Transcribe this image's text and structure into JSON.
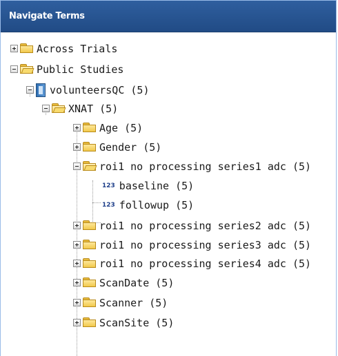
{
  "panel": {
    "title": "Navigate Terms"
  },
  "tree": {
    "across_trials": "Across Trials",
    "public_studies": "Public Studies",
    "volunteers": "volunteersQC (5)",
    "xnat": "XNAT (5)",
    "age": "Age (5)",
    "gender": "Gender (5)",
    "roi1_series1": "roi1 no processing series1 adc (5)",
    "numeric_badge": "123",
    "baseline": "baseline (5)",
    "followup": "followup (5)",
    "roi1_series2": "roi1 no processing series2 adc (5)",
    "roi1_series3": "roi1 no processing series3 adc (5)",
    "roi1_series4": "roi1 no processing series4 adc (5)",
    "scandate": "ScanDate (5)",
    "scanner": "Scanner (5)",
    "scansite": "ScanSite (5)"
  },
  "icons": {
    "expanded_toggle": "minus-box",
    "collapsed_toggle": "plus-box",
    "folder": "folder-icon",
    "open_folder": "open-folder-icon",
    "study": "study-icon",
    "numeric_leaf": "numeric-123-icon"
  },
  "colors": {
    "header_background": "#2a5895",
    "header_text": "#ffffff",
    "folder": "#f2c94c",
    "numeric_badge": "#1e3f8a"
  }
}
